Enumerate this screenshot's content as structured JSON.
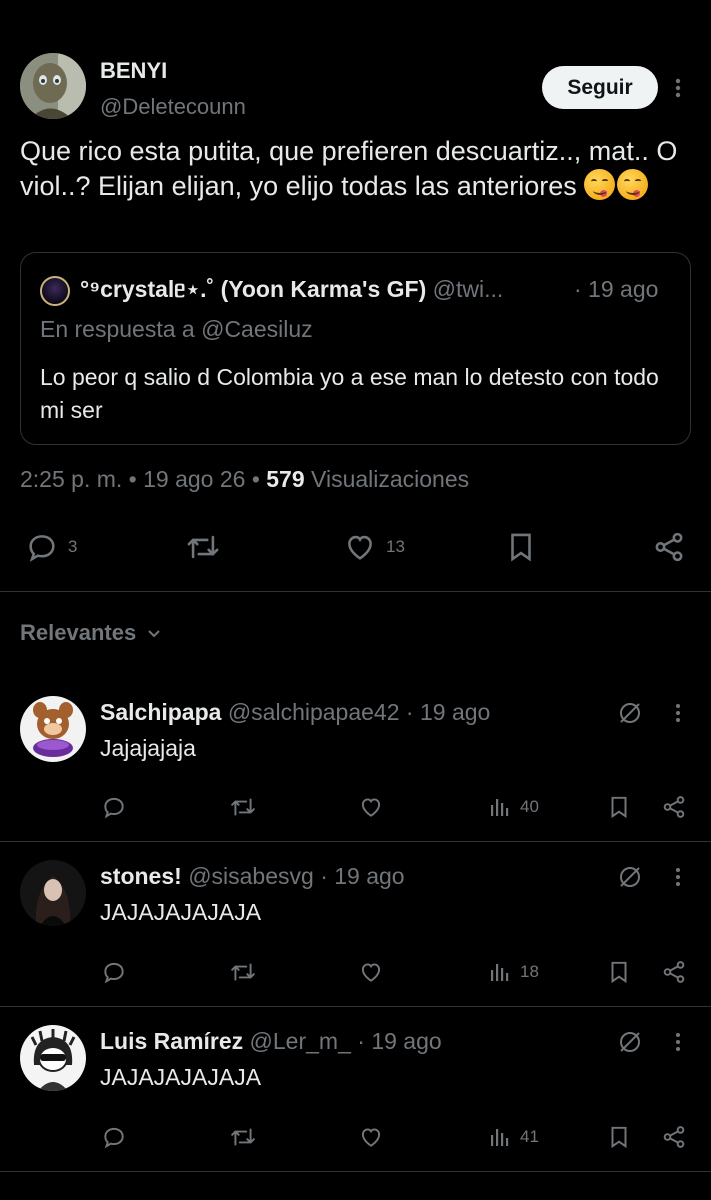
{
  "tweet": {
    "author_name": "BENYI",
    "author_handle": "@Deletecounn",
    "follow_label": "Seguir",
    "text": "Que rico esta putita, que prefieren descuartiz.., mat.. O viol..? Elijan elijan, yo elijo todas las anteriores",
    "quote": {
      "author_name": "°⁹crystalᥱ⋆.˚ (Yoon Karma's GF)",
      "author_handle": "@twi...",
      "date": "· 19 ago",
      "reply_to": "En respuesta a @Caesiluz",
      "text": "Lo peor q salio d Colombia yo a ese man lo detesto con todo mi ser"
    },
    "meta_prefix": "2:25 p. m. • 19 ago 26 •",
    "views_count": "579",
    "views_label": "Visualizaciones",
    "actions": {
      "reply_count": "3",
      "retweet_count": "",
      "like_count": "13"
    }
  },
  "relevant_label": "Relevantes",
  "replies": [
    {
      "name": "Salchipapa",
      "handle": "@salchipapae42",
      "date": "· 19 ago",
      "text": "Jajajajaja",
      "views": "40"
    },
    {
      "name": "stones!",
      "handle": "@sisabesvg",
      "date": "· 19 ago",
      "text": "JAJAJAJAJAJA",
      "views": "18"
    },
    {
      "name": "Luis Ramírez",
      "handle": "@Ler_m_",
      "date": "· 19 ago",
      "text": "JAJAJAJAJAJA",
      "views": "41"
    }
  ],
  "colors": {
    "background": "#000000",
    "text": "#e7e9ea",
    "muted": "#71767b",
    "border": "#2f3336"
  }
}
